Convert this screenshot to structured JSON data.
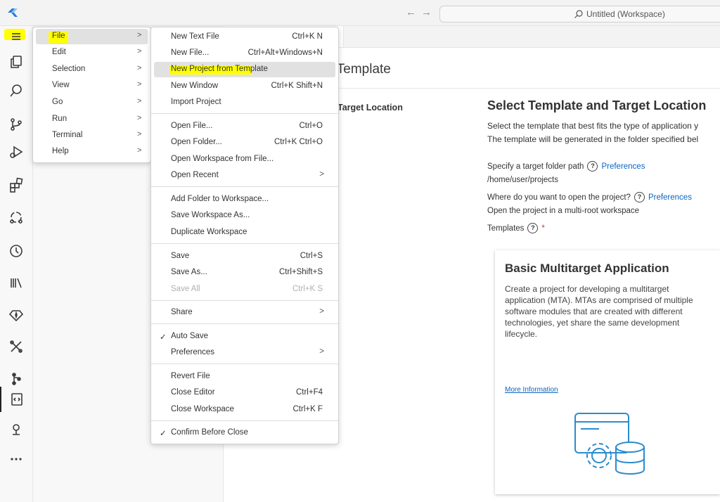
{
  "titlebar": {
    "nav_back": "←",
    "nav_forward": "→",
    "search_text": "Untitled (Workspace)"
  },
  "file_menu_label": "File",
  "main_menu": [
    {
      "label": "File",
      "chev": ">"
    },
    {
      "label": "Edit",
      "chev": ">"
    },
    {
      "label": "Selection",
      "chev": ">"
    },
    {
      "label": "View",
      "chev": ">"
    },
    {
      "label": "Go",
      "chev": ">"
    },
    {
      "label": "Run",
      "chev": ">"
    },
    {
      "label": "Terminal",
      "chev": ">"
    },
    {
      "label": "Help",
      "chev": ">"
    }
  ],
  "file_submenu": {
    "new_text_file": {
      "label": "New Text File",
      "kb": "Ctrl+K N"
    },
    "new_file": {
      "label": "New File...",
      "kb": "Ctrl+Alt+Windows+N"
    },
    "new_project_template": {
      "label": "New Project from Template"
    },
    "new_window": {
      "label": "New Window",
      "kb": "Ctrl+K Shift+N"
    },
    "import_project": {
      "label": "Import Project"
    },
    "open_file": {
      "label": "Open File...",
      "kb": "Ctrl+O"
    },
    "open_folder": {
      "label": "Open Folder...",
      "kb": "Ctrl+K Ctrl+O"
    },
    "open_workspace": {
      "label": "Open Workspace from File..."
    },
    "open_recent": {
      "label": "Open Recent",
      "chev": ">"
    },
    "add_folder": {
      "label": "Add Folder to Workspace..."
    },
    "save_workspace_as": {
      "label": "Save Workspace As..."
    },
    "duplicate_workspace": {
      "label": "Duplicate Workspace"
    },
    "save": {
      "label": "Save",
      "kb": "Ctrl+S"
    },
    "save_as": {
      "label": "Save As...",
      "kb": "Ctrl+Shift+S"
    },
    "save_all": {
      "label": "Save All",
      "kb": "Ctrl+K S"
    },
    "share": {
      "label": "Share",
      "chev": ">"
    },
    "auto_save": {
      "label": "Auto Save",
      "check": "✓"
    },
    "preferences": {
      "label": "Preferences",
      "chev": ">"
    },
    "revert_file": {
      "label": "Revert File"
    },
    "close_editor": {
      "label": "Close Editor",
      "kb": "Ctrl+F4"
    },
    "close_workspace": {
      "label": "Close Workspace",
      "kb": "Ctrl+K F"
    },
    "confirm_before_close": {
      "label": "Confirm Before Close",
      "check": "✓"
    }
  },
  "editor": {
    "page_title": "m Template",
    "step_label": "Target Location",
    "panel_title": "Select Template and Target Location",
    "panel_desc_1": "Select the template that best fits the type of application y",
    "panel_desc_2": "The template will be generated in the folder specified bel",
    "target_folder_label": "Specify a target folder path",
    "preferences_link": "Preferences",
    "target_folder_value": "/home/user/projects",
    "open_where_label": "Where do you want to open the project?",
    "open_where_value": "Open the project in a multi-root workspace",
    "templates_label": "Templates",
    "required_mark": "*",
    "help_mark": "?"
  },
  "card": {
    "title": "Basic Multitarget Application",
    "description": "Create a project for developing a multitarget application (MTA). MTAs are comprised of multiple software modules that are created with different technologies, yet share the same development lifecycle.",
    "more_info": "More Information"
  },
  "colors": {
    "highlight": "#ffff00",
    "link": "#0a63c2",
    "illustration": "#2a8ccf"
  }
}
